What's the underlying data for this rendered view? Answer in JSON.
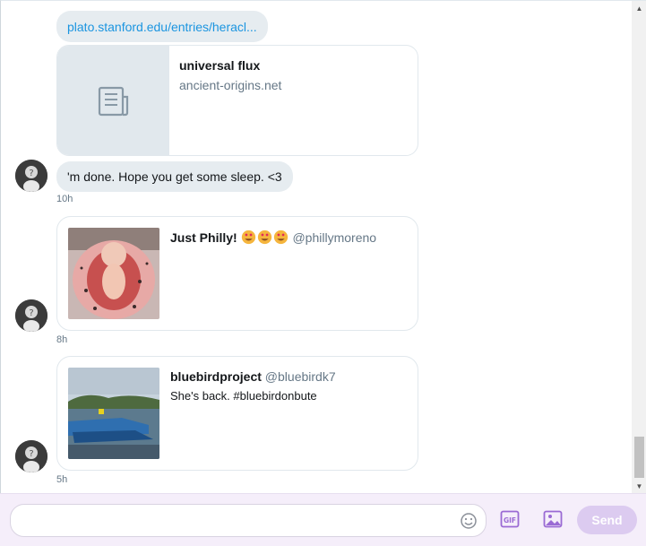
{
  "thread": {
    "link_message": {
      "url_text": "plato.stanford.edu/entries/heracl..."
    },
    "link_card": {
      "title": "universal flux",
      "domain": "ancient-origins.net",
      "icon": "document-icon"
    },
    "text_message": {
      "text": "'m done. Hope you get some sleep. <3",
      "timestamp": "10h"
    },
    "tweets": [
      {
        "name": "Just Philly!",
        "emoji_count": 3,
        "handle": "@phillymoreno",
        "text": "",
        "timestamp": "8h"
      },
      {
        "name": "bluebirdproject",
        "handle": "@bluebirdk7",
        "text": "She's back. #bluebirdonbute",
        "timestamp": "5h"
      }
    ]
  },
  "composer": {
    "placeholder": "",
    "value": "",
    "emoji_icon": "smiley-icon",
    "gif_icon": "gif-icon",
    "image_icon": "image-icon",
    "send_label": "Send"
  },
  "colors": {
    "accent": "#1b95e0",
    "send_disabled": "#dccbf0",
    "composer_bg": "#f5eefa",
    "icon_purple": "#9a6ad4"
  }
}
